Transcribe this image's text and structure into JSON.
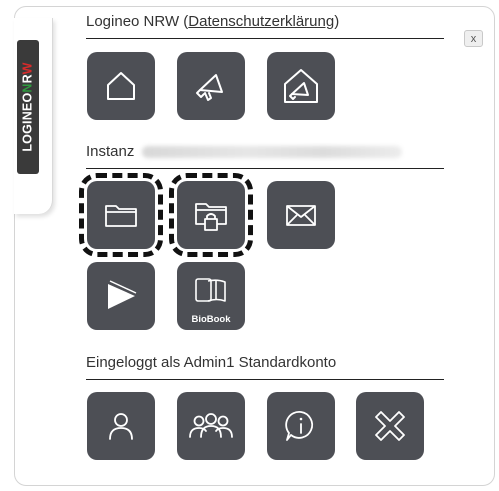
{
  "sidebar": {
    "logo_part1": "LOGINEO",
    "logo_n": "N",
    "logo_r": "R",
    "logo_w": "W"
  },
  "close_button": {
    "label": "x"
  },
  "section_logineo": {
    "title_prefix": "Logineo NRW (",
    "title_link": "Datenschutzerklärung",
    "title_suffix": ")"
  },
  "section_instanz": {
    "title": "Instanz"
  },
  "section_account": {
    "title": "Eingeloggt als Admin1 Standardkonto"
  },
  "tiles": {
    "biobook_caption": "BioBook"
  },
  "icons": [
    "home-icon",
    "megaphone-icon",
    "house-megaphone-icon",
    "folder-icon",
    "folder-lock-icon",
    "envelope-icon",
    "book-play-icon",
    "biobook-icon",
    "user-icon",
    "group-icon",
    "info-bubble-icon",
    "x-close-icon"
  ],
  "colors": {
    "tile_bg": "#4d4f55",
    "nrw_green": "#2e9a3e",
    "nrw_red": "#d92b2b",
    "sidebar_bg": "#3a3a3a"
  }
}
